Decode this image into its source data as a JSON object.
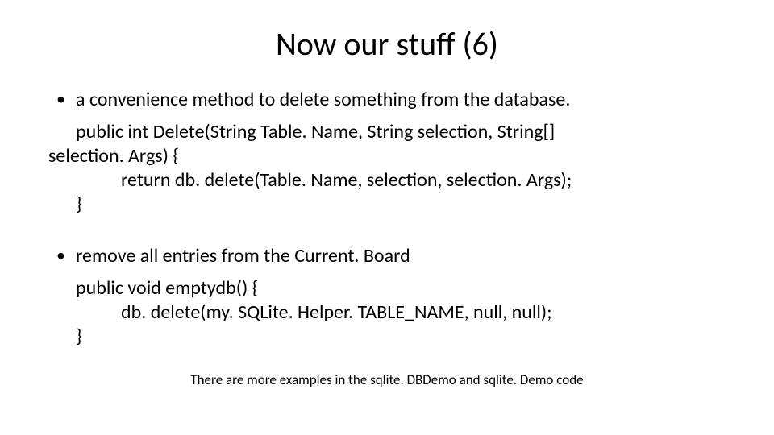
{
  "title": "Now our stuff (6)",
  "bullet1": " a convenience method to delete something from the database.",
  "code1_l1": "public int Delete(String Table. Name, String selection, String[]",
  "code1_l1b": "selection. Args) {",
  "code1_l2": "return db. delete(Table. Name, selection, selection. Args);",
  "code1_l3": "}",
  "bullet2": "remove all entries from the Current. Board",
  "code2_l1": "public void emptydb() {",
  "code2_l2": "db. delete(my. SQLite. Helper. TABLE_NAME, null, null);",
  "code2_l3": "}",
  "footer": "There are more examples in the sqlite. DBDemo and sqlite. Demo code"
}
